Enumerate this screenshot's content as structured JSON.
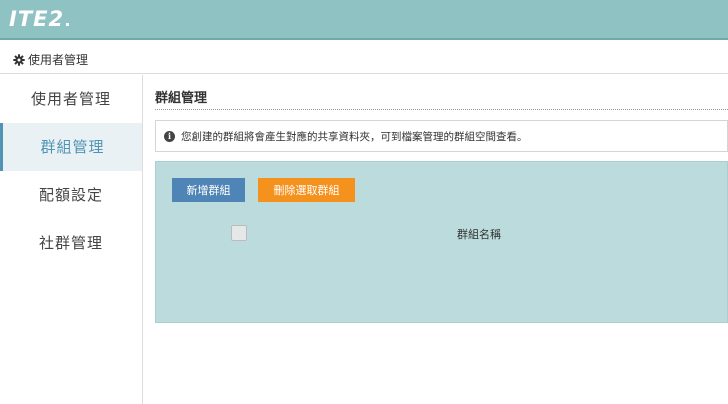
{
  "app": {
    "logo_text": "ITE2"
  },
  "breadcrumb": {
    "text": "使用者管理"
  },
  "sidebar": {
    "items": [
      {
        "label": "使用者管理"
      },
      {
        "label": "群組管理"
      },
      {
        "label": "配額設定"
      },
      {
        "label": "社群管理"
      }
    ]
  },
  "main": {
    "title": "群組管理",
    "info_text": "您創建的群組將會產生對應的共享資料夾，可到檔案管理的群組空間查看。",
    "add_label": "新增群組",
    "delete_label": "刪除選取群組",
    "column_header": "群組名稱"
  },
  "colors": {
    "header_bg": "#8fc3c3",
    "accent": "#4f94b4",
    "add_button": "#4f84b6",
    "delete_button": "#f5921e",
    "panel_bg": "#bcdbdc"
  }
}
